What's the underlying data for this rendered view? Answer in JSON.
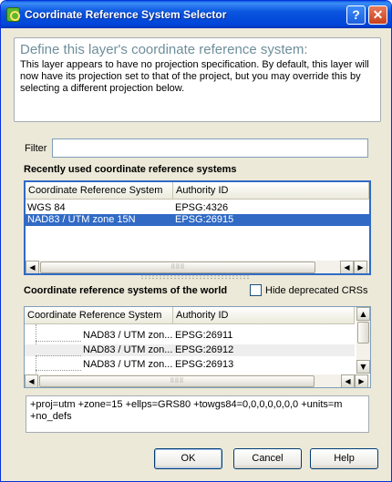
{
  "window": {
    "title": "Coordinate Reference System Selector",
    "help_button": "?",
    "close_button": "✕"
  },
  "define": {
    "title": "Define this layer's coordinate reference system:",
    "body": "This layer appears to have no projection specification. By default, this layer will now have its projection set to that of the project, but you may override this by selecting a different projection below."
  },
  "filter": {
    "label": "Filter",
    "value": ""
  },
  "recent": {
    "label": "Recently used coordinate reference systems",
    "columns": [
      "Coordinate Reference System",
      "Authority ID"
    ],
    "rows": [
      {
        "name": "WGS 84",
        "id": "EPSG:4326",
        "selected": false
      },
      {
        "name": "NAD83 / UTM zone 15N",
        "id": "EPSG:26915",
        "selected": true
      }
    ]
  },
  "world": {
    "label": "Coordinate reference systems of the world",
    "hide_deprecated": {
      "label": "Hide deprecated CRSs",
      "checked": false
    },
    "columns": [
      "Coordinate Reference System",
      "Authority ID"
    ],
    "rows": [
      {
        "name": "NAD83 / UTM zon...",
        "id": "EPSG:26911"
      },
      {
        "name": "NAD83 / UTM zon...",
        "id": "EPSG:26912"
      },
      {
        "name": "NAD83 / UTM zon...",
        "id": "EPSG:26913"
      }
    ]
  },
  "proj_string": "+proj=utm +zone=15 +ellps=GRS80 +towgs84=0,0,0,0,0,0,0 +units=m +no_defs",
  "buttons": {
    "ok": "OK",
    "cancel": "Cancel",
    "help": "Help"
  },
  "colors": {
    "selection": "#316ac5",
    "title_bar": "#0a55e0",
    "define_title": "#6e8e9b"
  }
}
